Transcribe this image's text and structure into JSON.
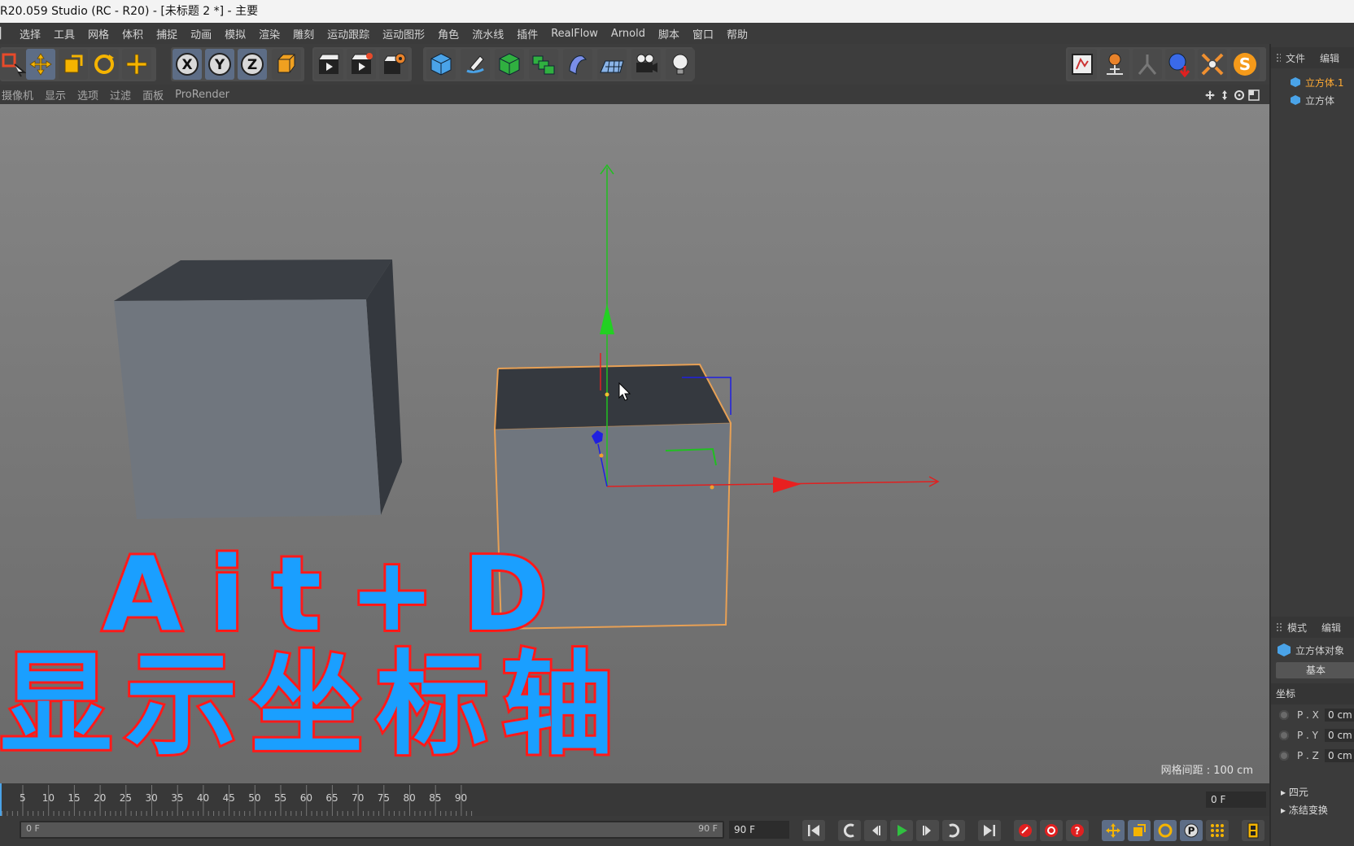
{
  "window": {
    "title": "R20.059 Studio (RC - R20) - [未标题 2 *] - 主要"
  },
  "menu": [
    "选择",
    "工具",
    "网格",
    "体积",
    "捕捉",
    "动画",
    "模拟",
    "渲染",
    "雕刻",
    "运动跟踪",
    "运动图形",
    "角色",
    "流水线",
    "插件",
    "RealFlow",
    "Arnold",
    "脚本",
    "窗口",
    "帮助"
  ],
  "toolbar": {
    "axis_x": "X",
    "axis_y": "Y",
    "axis_z": "Z",
    "icons": [
      "select-icon",
      "move-icon",
      "scale-icon",
      "rotate-icon",
      "transform-icon",
      "axis-x-icon",
      "axis-y-icon",
      "axis-z-icon",
      "coordinate-system-icon",
      "render-view-icon",
      "render-picture-viewer-icon",
      "render-settings-icon",
      "cube-primitive-icon",
      "pen-icon",
      "subdivision-icon",
      "array-icon",
      "deformer-icon",
      "floor-icon",
      "camera-icon",
      "light-icon"
    ],
    "right_icons": [
      "layout-icon",
      "edit-icon",
      "character-icon",
      "sphere-icon",
      "explode-icon",
      "s-plugin-icon"
    ]
  },
  "viewport": {
    "menu": [
      "摄像机",
      "显示",
      "选项",
      "过滤",
      "面板",
      "ProRender"
    ],
    "grid_spacing": "网格间距 : 100 cm",
    "overlay_line1": "Ait+D",
    "overlay_line2": "显示坐标轴"
  },
  "objects_panel": {
    "tabs": [
      "文件",
      "编辑"
    ],
    "items": [
      {
        "name": "立方体.1",
        "active": true
      },
      {
        "name": "立方体",
        "active": false
      }
    ]
  },
  "attributes_panel": {
    "tabs": [
      "模式",
      "编辑"
    ],
    "object_type": "立方体对象",
    "tab_basic": "基本",
    "section": "坐标",
    "props": [
      {
        "label": "P . X",
        "value": "0 cm"
      },
      {
        "label": "P . Y",
        "value": "0 cm"
      },
      {
        "label": "P . Z",
        "value": "0 cm"
      }
    ],
    "expand1": "四元",
    "expand2": "冻结变换"
  },
  "timeline": {
    "ticks": [
      5,
      10,
      15,
      20,
      25,
      30,
      35,
      40,
      45,
      50,
      55,
      60,
      65,
      70,
      75,
      80,
      85,
      90
    ],
    "current_frame": "0 F",
    "range_start": "0 F",
    "range_end": "90 F",
    "end_frame": "90 F"
  },
  "colors": {
    "accent_selection": "#ffaa33",
    "overlay_fill": "#1a9fff",
    "overlay_stroke": "#ff1a1a",
    "axis_x": "#e02020",
    "axis_y": "#20c020",
    "axis_z": "#2020e0"
  }
}
